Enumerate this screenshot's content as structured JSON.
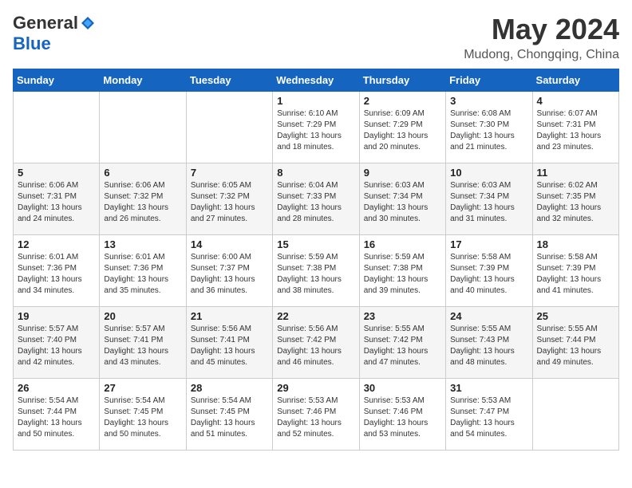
{
  "header": {
    "logo": {
      "general": "General",
      "blue": "Blue"
    },
    "title": "May 2024",
    "location": "Mudong, Chongqing, China"
  },
  "days_of_week": [
    "Sunday",
    "Monday",
    "Tuesday",
    "Wednesday",
    "Thursday",
    "Friday",
    "Saturday"
  ],
  "weeks": [
    [
      {
        "day": "",
        "info": ""
      },
      {
        "day": "",
        "info": ""
      },
      {
        "day": "",
        "info": ""
      },
      {
        "day": "1",
        "info": "Sunrise: 6:10 AM\nSunset: 7:29 PM\nDaylight: 13 hours and 18 minutes."
      },
      {
        "day": "2",
        "info": "Sunrise: 6:09 AM\nSunset: 7:29 PM\nDaylight: 13 hours and 20 minutes."
      },
      {
        "day": "3",
        "info": "Sunrise: 6:08 AM\nSunset: 7:30 PM\nDaylight: 13 hours and 21 minutes."
      },
      {
        "day": "4",
        "info": "Sunrise: 6:07 AM\nSunset: 7:31 PM\nDaylight: 13 hours and 23 minutes."
      }
    ],
    [
      {
        "day": "5",
        "info": "Sunrise: 6:06 AM\nSunset: 7:31 PM\nDaylight: 13 hours and 24 minutes."
      },
      {
        "day": "6",
        "info": "Sunrise: 6:06 AM\nSunset: 7:32 PM\nDaylight: 13 hours and 26 minutes."
      },
      {
        "day": "7",
        "info": "Sunrise: 6:05 AM\nSunset: 7:32 PM\nDaylight: 13 hours and 27 minutes."
      },
      {
        "day": "8",
        "info": "Sunrise: 6:04 AM\nSunset: 7:33 PM\nDaylight: 13 hours and 28 minutes."
      },
      {
        "day": "9",
        "info": "Sunrise: 6:03 AM\nSunset: 7:34 PM\nDaylight: 13 hours and 30 minutes."
      },
      {
        "day": "10",
        "info": "Sunrise: 6:03 AM\nSunset: 7:34 PM\nDaylight: 13 hours and 31 minutes."
      },
      {
        "day": "11",
        "info": "Sunrise: 6:02 AM\nSunset: 7:35 PM\nDaylight: 13 hours and 32 minutes."
      }
    ],
    [
      {
        "day": "12",
        "info": "Sunrise: 6:01 AM\nSunset: 7:36 PM\nDaylight: 13 hours and 34 minutes."
      },
      {
        "day": "13",
        "info": "Sunrise: 6:01 AM\nSunset: 7:36 PM\nDaylight: 13 hours and 35 minutes."
      },
      {
        "day": "14",
        "info": "Sunrise: 6:00 AM\nSunset: 7:37 PM\nDaylight: 13 hours and 36 minutes."
      },
      {
        "day": "15",
        "info": "Sunrise: 5:59 AM\nSunset: 7:38 PM\nDaylight: 13 hours and 38 minutes."
      },
      {
        "day": "16",
        "info": "Sunrise: 5:59 AM\nSunset: 7:38 PM\nDaylight: 13 hours and 39 minutes."
      },
      {
        "day": "17",
        "info": "Sunrise: 5:58 AM\nSunset: 7:39 PM\nDaylight: 13 hours and 40 minutes."
      },
      {
        "day": "18",
        "info": "Sunrise: 5:58 AM\nSunset: 7:39 PM\nDaylight: 13 hours and 41 minutes."
      }
    ],
    [
      {
        "day": "19",
        "info": "Sunrise: 5:57 AM\nSunset: 7:40 PM\nDaylight: 13 hours and 42 minutes."
      },
      {
        "day": "20",
        "info": "Sunrise: 5:57 AM\nSunset: 7:41 PM\nDaylight: 13 hours and 43 minutes."
      },
      {
        "day": "21",
        "info": "Sunrise: 5:56 AM\nSunset: 7:41 PM\nDaylight: 13 hours and 45 minutes."
      },
      {
        "day": "22",
        "info": "Sunrise: 5:56 AM\nSunset: 7:42 PM\nDaylight: 13 hours and 46 minutes."
      },
      {
        "day": "23",
        "info": "Sunrise: 5:55 AM\nSunset: 7:42 PM\nDaylight: 13 hours and 47 minutes."
      },
      {
        "day": "24",
        "info": "Sunrise: 5:55 AM\nSunset: 7:43 PM\nDaylight: 13 hours and 48 minutes."
      },
      {
        "day": "25",
        "info": "Sunrise: 5:55 AM\nSunset: 7:44 PM\nDaylight: 13 hours and 49 minutes."
      }
    ],
    [
      {
        "day": "26",
        "info": "Sunrise: 5:54 AM\nSunset: 7:44 PM\nDaylight: 13 hours and 50 minutes."
      },
      {
        "day": "27",
        "info": "Sunrise: 5:54 AM\nSunset: 7:45 PM\nDaylight: 13 hours and 50 minutes."
      },
      {
        "day": "28",
        "info": "Sunrise: 5:54 AM\nSunset: 7:45 PM\nDaylight: 13 hours and 51 minutes."
      },
      {
        "day": "29",
        "info": "Sunrise: 5:53 AM\nSunset: 7:46 PM\nDaylight: 13 hours and 52 minutes."
      },
      {
        "day": "30",
        "info": "Sunrise: 5:53 AM\nSunset: 7:46 PM\nDaylight: 13 hours and 53 minutes."
      },
      {
        "day": "31",
        "info": "Sunrise: 5:53 AM\nSunset: 7:47 PM\nDaylight: 13 hours and 54 minutes."
      },
      {
        "day": "",
        "info": ""
      }
    ]
  ]
}
